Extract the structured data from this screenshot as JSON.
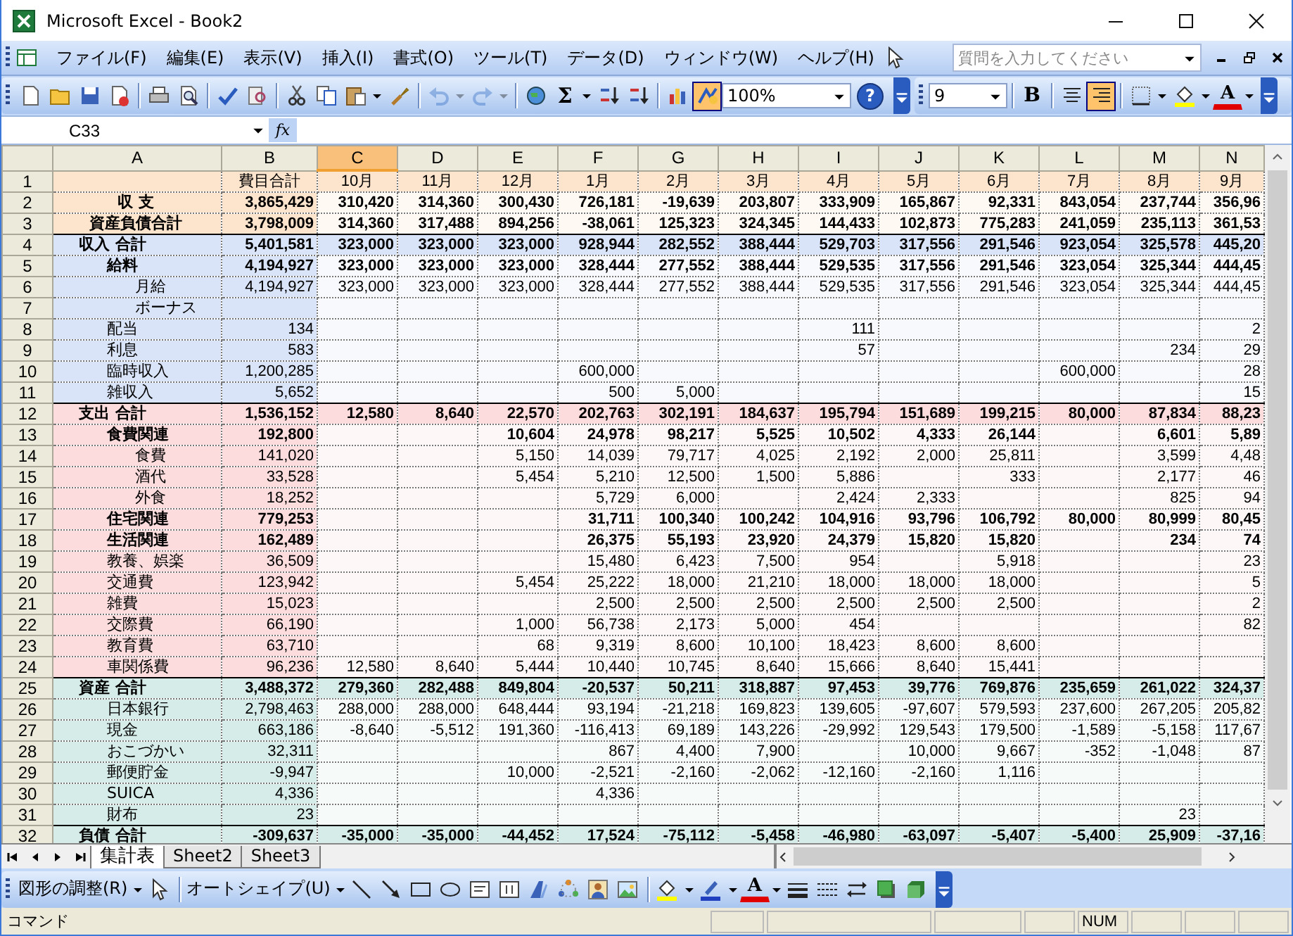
{
  "window": {
    "title": "Microsoft Excel - Book2"
  },
  "menu": [
    {
      "label": "ファイル(F)",
      "selected": false
    },
    {
      "label": "編集(E)",
      "selected": false
    },
    {
      "label": "表示(V)",
      "selected": false
    },
    {
      "label": "挿入(I)",
      "selected": false
    },
    {
      "label": "書式(O)",
      "selected": false
    },
    {
      "label": "ツール(T)",
      "selected": false
    },
    {
      "label": "データ(D)",
      "selected": false
    },
    {
      "label": "ウィンドウ(W)",
      "selected": false
    },
    {
      "label": "ヘルプ(H)",
      "selected": false
    }
  ],
  "help_search": {
    "placeholder": "質問を入力してください"
  },
  "standard_toolbar": [
    {
      "kind": "page"
    },
    {
      "kind": "folder"
    },
    {
      "kind": "disk"
    },
    {
      "kind": "lockpage"
    },
    {
      "kind": "separator"
    },
    {
      "kind": "printer"
    },
    {
      "kind": "preview"
    },
    {
      "kind": "separator"
    },
    {
      "kind": "spellcheck"
    },
    {
      "kind": "research"
    },
    {
      "kind": "separator"
    },
    {
      "kind": "scissors"
    },
    {
      "kind": "copy"
    },
    {
      "kind": "paste",
      "dropdown": true
    },
    {
      "kind": "brush"
    },
    {
      "kind": "separator"
    },
    {
      "kind": "undo",
      "dropdown": true,
      "disabled": true
    },
    {
      "kind": "redo",
      "dropdown": true,
      "disabled": true
    },
    {
      "kind": "separator"
    },
    {
      "kind": "globe"
    },
    {
      "kind": "glyph",
      "label": "Σ",
      "dropdown": true
    },
    {
      "kind": "sortup"
    },
    {
      "kind": "sortdown"
    },
    {
      "kind": "separator"
    },
    {
      "kind": "chart"
    },
    {
      "kind": "drawing",
      "pressed": true
    },
    {
      "kind": "zoom",
      "value": "100%"
    },
    {
      "kind": "help",
      "label": "?"
    }
  ],
  "formatting_toolbar": [
    {
      "kind": "fontsize",
      "value": "9"
    },
    {
      "kind": "separator"
    },
    {
      "kind": "glyph",
      "label": "B"
    },
    {
      "kind": "separator"
    },
    {
      "kind": "aligncenter"
    },
    {
      "kind": "alignright",
      "pressed": true
    },
    {
      "kind": "separator"
    },
    {
      "kind": "borders",
      "dropdown": true
    },
    {
      "kind": "bucket",
      "dropdown": true
    },
    {
      "kind": "fontcolor",
      "label": "A",
      "dropdown": true
    }
  ],
  "formula_bar": {
    "name_box": "C33",
    "fx": "fx"
  },
  "columns": [
    {
      "label": "A",
      "selected": false
    },
    {
      "label": "B",
      "selected": false
    },
    {
      "label": "C",
      "selected": true
    },
    {
      "label": "D",
      "selected": false
    },
    {
      "label": "E",
      "selected": false
    },
    {
      "label": "F",
      "selected": false
    },
    {
      "label": "G",
      "selected": false
    },
    {
      "label": "H",
      "selected": false
    },
    {
      "label": "I",
      "selected": false
    },
    {
      "label": "J",
      "selected": false
    },
    {
      "label": "K",
      "selected": false
    },
    {
      "label": "L",
      "selected": false
    },
    {
      "label": "M",
      "selected": false
    },
    {
      "label": "N",
      "selected": false
    }
  ],
  "rows": [
    {
      "number": "1",
      "kind": "months",
      "color": "#fde4cc",
      "cells": [
        "費目合計",
        "10月",
        "11月",
        "12月",
        "1月",
        "2月",
        "3月",
        "4月",
        "5月",
        "6月",
        "7月",
        "8月",
        "9月"
      ]
    },
    {
      "number": "2",
      "kind": "summary",
      "color": "#fde4cc",
      "label": "収 支",
      "cells": [
        "3,865,429",
        "310,420",
        "314,360",
        "300,430",
        "726,181",
        "-19,639",
        "203,807",
        "333,909",
        "165,867",
        "92,331",
        "843,054",
        "237,744",
        "356,96"
      ]
    },
    {
      "number": "3",
      "kind": "summary",
      "color": "#fde4cc",
      "label": "資産負債合計",
      "cells": [
        "3,798,009",
        "314,360",
        "317,488",
        "894,256",
        "-38,061",
        "125,323",
        "324,345",
        "144,433",
        "102,873",
        "775,283",
        "241,059",
        "235,113",
        "361,53"
      ]
    },
    {
      "number": "4",
      "kind": "total",
      "color": "#d9e4f8",
      "label": "収入 合計",
      "cells": [
        "5,401,581",
        "323,000",
        "323,000",
        "323,000",
        "928,944",
        "282,552",
        "388,444",
        "529,703",
        "317,556",
        "291,546",
        "923,054",
        "325,578",
        "445,20"
      ]
    },
    {
      "number": "5",
      "kind": "subtotal",
      "color": "#d9e4f8",
      "label": "給料",
      "cells": [
        "4,194,927",
        "323,000",
        "323,000",
        "323,000",
        "328,444",
        "277,552",
        "388,444",
        "529,535",
        "317,556",
        "291,546",
        "323,054",
        "325,344",
        "444,45"
      ]
    },
    {
      "number": "6",
      "kind": "subitem",
      "color": "#d9e4f8",
      "label": "月給",
      "cells": [
        "4,194,927",
        "323,000",
        "323,000",
        "323,000",
        "328,444",
        "277,552",
        "388,444",
        "529,535",
        "317,556",
        "291,546",
        "323,054",
        "325,344",
        "444,45"
      ]
    },
    {
      "number": "7",
      "kind": "subitem",
      "color": "#d9e4f8",
      "label": "ボーナス",
      "cells": [
        null,
        null,
        null,
        null,
        null,
        null,
        null,
        null,
        null,
        null,
        null,
        null,
        null
      ]
    },
    {
      "number": "8",
      "kind": "item",
      "color": "#d9e4f8",
      "label": "配当",
      "cells": [
        "134",
        null,
        null,
        null,
        null,
        null,
        null,
        "111",
        null,
        null,
        null,
        null,
        "2"
      ]
    },
    {
      "number": "9",
      "kind": "item",
      "color": "#d9e4f8",
      "label": "利息",
      "cells": [
        "583",
        null,
        null,
        null,
        null,
        null,
        null,
        "57",
        null,
        null,
        null,
        "234",
        "29"
      ]
    },
    {
      "number": "10",
      "kind": "item",
      "color": "#d9e4f8",
      "label": "臨時収入",
      "cells": [
        "1,200,285",
        null,
        null,
        null,
        "600,000",
        null,
        null,
        null,
        null,
        null,
        "600,000",
        null,
        "28"
      ]
    },
    {
      "number": "11",
      "kind": "item",
      "color": "#d9e4f8",
      "label": "雑収入",
      "cells": [
        "5,652",
        null,
        null,
        null,
        "500",
        "5,000",
        null,
        null,
        null,
        null,
        null,
        null,
        "15"
      ]
    },
    {
      "number": "12",
      "kind": "total",
      "color": "#fcdcdc",
      "label": "支出 合計",
      "cells": [
        "1,536,152",
        "12,580",
        "8,640",
        "22,570",
        "202,763",
        "302,191",
        "184,637",
        "195,794",
        "151,689",
        "199,215",
        "80,000",
        "87,834",
        "88,23"
      ]
    },
    {
      "number": "13",
      "kind": "subtotal",
      "color": "#fcdcdc",
      "label": "食費関連",
      "cells": [
        "192,800",
        null,
        null,
        "10,604",
        "24,978",
        "98,217",
        "5,525",
        "10,502",
        "4,333",
        "26,144",
        null,
        "6,601",
        "5,89"
      ]
    },
    {
      "number": "14",
      "kind": "subitem",
      "color": "#fcdcdc",
      "label": "食費",
      "cells": [
        "141,020",
        null,
        null,
        "5,150",
        "14,039",
        "79,717",
        "4,025",
        "2,192",
        "2,000",
        "25,811",
        null,
        "3,599",
        "4,48"
      ]
    },
    {
      "number": "15",
      "kind": "subitem",
      "color": "#fcdcdc",
      "label": "酒代",
      "cells": [
        "33,528",
        null,
        null,
        "5,454",
        "5,210",
        "12,500",
        "1,500",
        "5,886",
        null,
        "333",
        null,
        "2,177",
        "46"
      ]
    },
    {
      "number": "16",
      "kind": "subitem",
      "color": "#fcdcdc",
      "label": "外食",
      "cells": [
        "18,252",
        null,
        null,
        null,
        "5,729",
        "6,000",
        null,
        "2,424",
        "2,333",
        null,
        null,
        "825",
        "94"
      ]
    },
    {
      "number": "17",
      "kind": "subtotal",
      "color": "#fcdcdc",
      "label": "住宅関連",
      "cells": [
        "779,253",
        null,
        null,
        null,
        "31,711",
        "100,340",
        "100,242",
        "104,916",
        "93,796",
        "106,792",
        "80,000",
        "80,999",
        "80,45"
      ]
    },
    {
      "number": "18",
      "kind": "subtotal",
      "color": "#fcdcdc",
      "label": "生活関連",
      "cells": [
        "162,489",
        null,
        null,
        null,
        "26,375",
        "55,193",
        "23,920",
        "24,379",
        "15,820",
        "15,820",
        null,
        "234",
        "74"
      ]
    },
    {
      "number": "19",
      "kind": "item",
      "color": "#fcdcdc",
      "label": "教養、娯楽",
      "cells": [
        "36,509",
        null,
        null,
        null,
        "15,480",
        "6,423",
        "7,500",
        "954",
        null,
        "5,918",
        null,
        null,
        "23"
      ]
    },
    {
      "number": "20",
      "kind": "item",
      "color": "#fcdcdc",
      "label": "交通費",
      "cells": [
        "123,942",
        null,
        null,
        "5,454",
        "25,222",
        "18,000",
        "21,210",
        "18,000",
        "18,000",
        "18,000",
        null,
        null,
        "5"
      ]
    },
    {
      "number": "21",
      "kind": "item",
      "color": "#fcdcdc",
      "label": "雑費",
      "cells": [
        "15,023",
        null,
        null,
        null,
        "2,500",
        "2,500",
        "2,500",
        "2,500",
        "2,500",
        "2,500",
        null,
        null,
        "2"
      ]
    },
    {
      "number": "22",
      "kind": "item",
      "color": "#fcdcdc",
      "label": "交際費",
      "cells": [
        "66,190",
        null,
        null,
        "1,000",
        "56,738",
        "2,173",
        "5,000",
        "454",
        null,
        null,
        null,
        null,
        "82"
      ]
    },
    {
      "number": "23",
      "kind": "item",
      "color": "#fcdcdc",
      "label": "教育費",
      "cells": [
        "63,710",
        null,
        null,
        "68",
        "9,319",
        "8,600",
        "10,100",
        "18,423",
        "8,600",
        "8,600",
        null,
        null,
        null
      ]
    },
    {
      "number": "24",
      "kind": "item",
      "color": "#fcdcdc",
      "label": "車関係費",
      "cells": [
        "96,236",
        "12,580",
        "8,640",
        "5,444",
        "10,440",
        "10,745",
        "8,640",
        "15,666",
        "8,640",
        "15,441",
        null,
        null,
        null
      ]
    },
    {
      "number": "25",
      "kind": "total",
      "color": "#d5ece8",
      "label": "資産 合計",
      "cells": [
        "3,488,372",
        "279,360",
        "282,488",
        "849,804",
        "-20,537",
        "50,211",
        "318,887",
        "97,453",
        "39,776",
        "769,876",
        "235,659",
        "261,022",
        "324,37"
      ]
    },
    {
      "number": "26",
      "kind": "item",
      "color": "#d5ece8",
      "label": "日本銀行",
      "cells": [
        "2,798,463",
        "288,000",
        "288,000",
        "648,444",
        "93,194",
        "-21,218",
        "169,823",
        "139,605",
        "-97,607",
        "579,593",
        "237,600",
        "267,205",
        "205,82"
      ]
    },
    {
      "number": "27",
      "kind": "item",
      "color": "#d5ece8",
      "label": "現金",
      "cells": [
        "663,186",
        "-8,640",
        "-5,512",
        "191,360",
        "-116,413",
        "69,189",
        "143,226",
        "-29,992",
        "129,543",
        "179,500",
        "-1,589",
        "-5,158",
        "117,67"
      ]
    },
    {
      "number": "28",
      "kind": "item",
      "color": "#d5ece8",
      "label": "おこづかい",
      "cells": [
        "32,311",
        null,
        null,
        null,
        "867",
        "4,400",
        "7,900",
        null,
        "10,000",
        "9,667",
        "-352",
        "-1,048",
        "87"
      ]
    },
    {
      "number": "29",
      "kind": "item",
      "color": "#d5ece8",
      "label": "郵便貯金",
      "cells": [
        "-9,947",
        null,
        null,
        "10,000",
        "-2,521",
        "-2,160",
        "-2,062",
        "-12,160",
        "-2,160",
        "1,116",
        null,
        null,
        null
      ]
    },
    {
      "number": "30",
      "kind": "item",
      "color": "#d5ece8",
      "label": "SUICA",
      "cells": [
        "4,336",
        null,
        null,
        null,
        "4,336",
        null,
        null,
        null,
        null,
        null,
        null,
        null,
        null
      ]
    },
    {
      "number": "31",
      "kind": "item",
      "color": "#d5ece8",
      "label": "財布",
      "cells": [
        "23",
        null,
        null,
        null,
        null,
        null,
        null,
        null,
        null,
        null,
        null,
        "23",
        null
      ]
    },
    {
      "number": "32",
      "kind": "total",
      "color": "#d5ece8",
      "label": "負債 合計",
      "cells": [
        "-309,637",
        "-35,000",
        "-35,000",
        "-44,452",
        "17,524",
        "-75,112",
        "-5,458",
        "-46,980",
        "-63,097",
        "-5,407",
        "-5,400",
        "25,909",
        "-37,16"
      ]
    }
  ],
  "sheet_tabs": [
    {
      "label": "集計表",
      "selected": true
    },
    {
      "label": "Sheet2",
      "selected": false
    },
    {
      "label": "Sheet3",
      "selected": false
    }
  ],
  "drawing_toolbar": [
    {
      "kind": "menu",
      "label": "図形の調整(R)",
      "dropdown": true
    },
    {
      "kind": "pointer"
    },
    {
      "kind": "separator"
    },
    {
      "kind": "menu",
      "label": "オートシェイプ(U)",
      "dropdown": true
    },
    {
      "kind": "line"
    },
    {
      "kind": "arrow"
    },
    {
      "kind": "rect"
    },
    {
      "kind": "oval"
    },
    {
      "kind": "textbox"
    },
    {
      "kind": "vtextbox"
    },
    {
      "kind": "wordart"
    },
    {
      "kind": "diagram"
    },
    {
      "kind": "clipart"
    },
    {
      "kind": "picture"
    },
    {
      "kind": "separator"
    },
    {
      "kind": "bucket",
      "dropdown": true
    },
    {
      "kind": "pen",
      "dropdown": true
    },
    {
      "kind": "fontcolor",
      "label": "A",
      "dropdown": true
    },
    {
      "kind": "linestyle"
    },
    {
      "kind": "dashstyle"
    },
    {
      "kind": "arrows"
    },
    {
      "kind": "shadow"
    },
    {
      "kind": "cube"
    }
  ],
  "status_bar": {
    "mode": "コマンド",
    "num": "NUM"
  }
}
